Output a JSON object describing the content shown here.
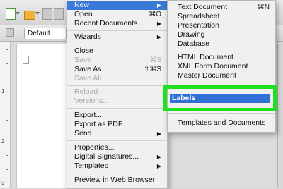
{
  "toolbar": {
    "paragraph_style": "Default"
  },
  "ruler": {
    "numbers": [
      "1",
      "2",
      "3"
    ]
  },
  "file_menu": {
    "items": [
      {
        "label": "New",
        "arrow": "▶",
        "highlighted": true
      },
      {
        "label": "Open...",
        "shortcut": "⌘O"
      },
      {
        "label": "Recent Documents",
        "arrow": "▶"
      },
      {
        "label": "Wizards",
        "arrow": "▶"
      },
      {
        "label": "Close"
      },
      {
        "label": "Save",
        "shortcut": "⌘S",
        "disabled": true
      },
      {
        "label": "Save As...",
        "shortcut": "⇧⌘S"
      },
      {
        "label": "Save All",
        "disabled": true
      },
      {
        "label": "Reload",
        "disabled": true
      },
      {
        "label": "Versions...",
        "disabled": true
      },
      {
        "label": "Export..."
      },
      {
        "label": "Export as PDF..."
      },
      {
        "label": "Send",
        "arrow": "▶"
      },
      {
        "label": "Properties..."
      },
      {
        "label": "Digital Signatures...",
        "arrow": "▶"
      },
      {
        "label": "Templates",
        "arrow": "▶"
      },
      {
        "label": "Preview in Web Browser"
      }
    ]
  },
  "new_menu": {
    "items": [
      {
        "label": "Text Document",
        "shortcut": "⌘N"
      },
      {
        "label": "Spreadsheet"
      },
      {
        "label": "Presentation"
      },
      {
        "label": "Drawing"
      },
      {
        "label": "Database"
      },
      {
        "label": "HTML Document"
      },
      {
        "label": "XML Form Document"
      },
      {
        "label": "Master Document"
      },
      {
        "label": "Labels",
        "highlighted": true
      },
      {
        "label": "Templates and Documents"
      }
    ]
  },
  "colors": {
    "highlight": "#3a7ad6",
    "annotation_box": "#1ee01e"
  }
}
